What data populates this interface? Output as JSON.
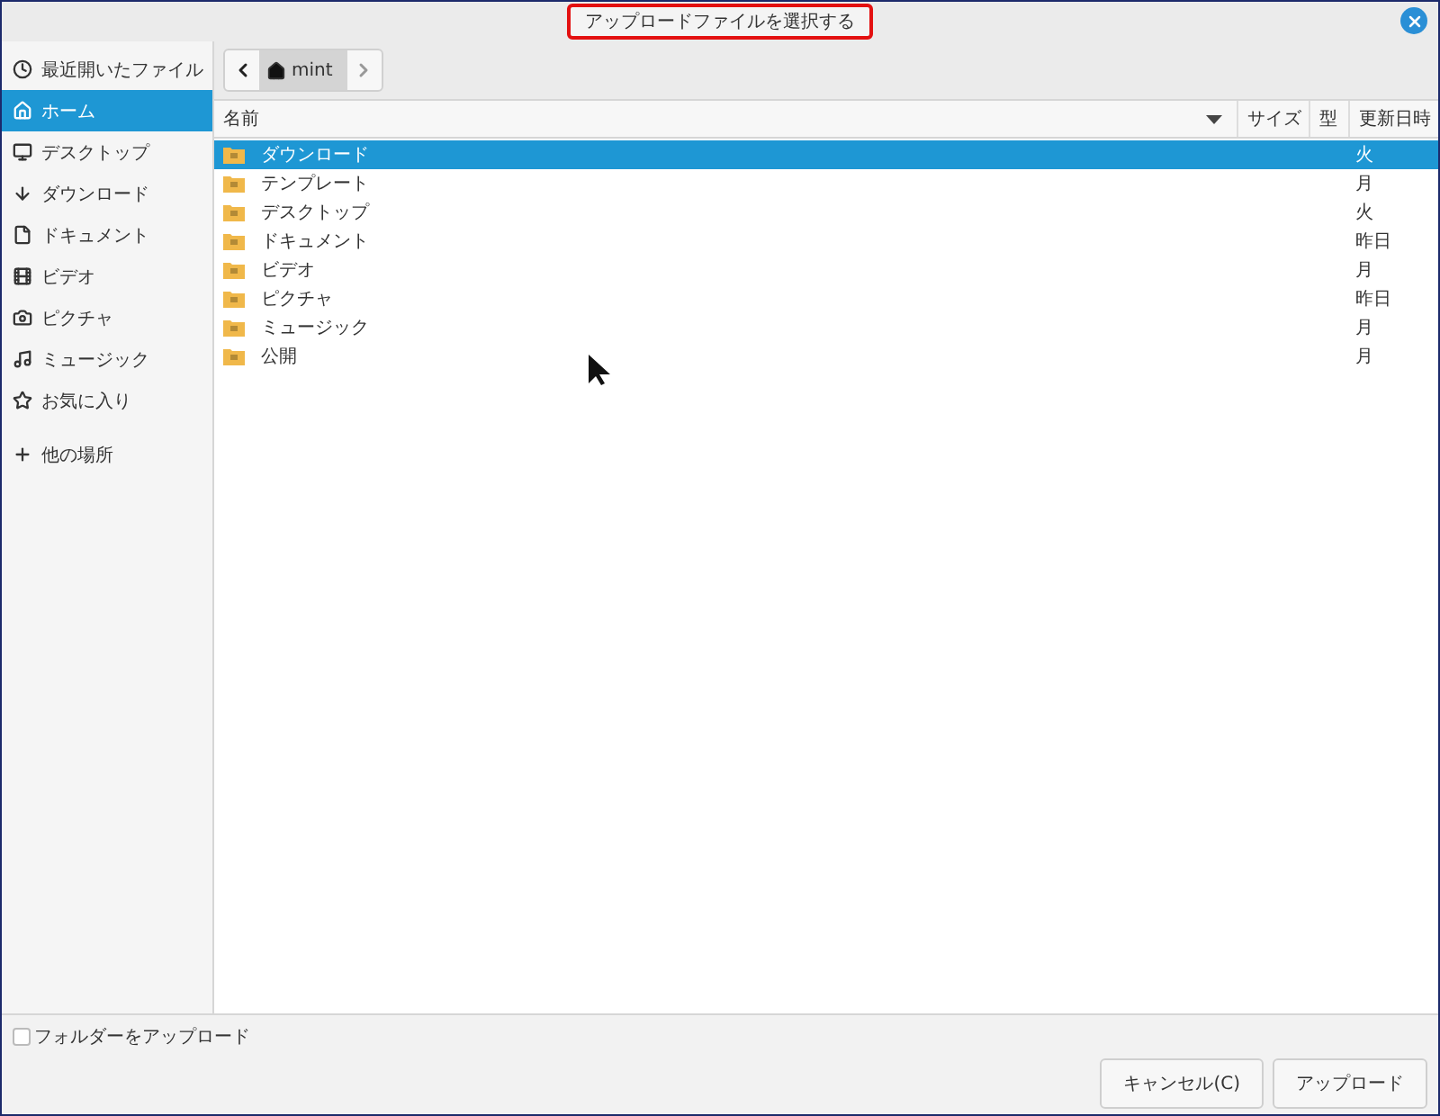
{
  "window": {
    "title": "アップロードファイルを選択する"
  },
  "sidebar": {
    "items": [
      {
        "label": "最近開いたファイル",
        "selected": false
      },
      {
        "label": "ホーム",
        "selected": true
      },
      {
        "label": "デスクトップ",
        "selected": false
      },
      {
        "label": "ダウンロード",
        "selected": false
      },
      {
        "label": "ドキュメント",
        "selected": false
      },
      {
        "label": "ビデオ",
        "selected": false
      },
      {
        "label": "ピクチャ",
        "selected": false
      },
      {
        "label": "ミュージック",
        "selected": false
      },
      {
        "label": "お気に入り",
        "selected": false
      },
      {
        "label": "他の場所",
        "selected": false
      }
    ]
  },
  "path_bar": {
    "segments": [
      {
        "label": "mint",
        "selected": true
      }
    ]
  },
  "table": {
    "columns": [
      "名前",
      "サイズ",
      "型",
      "更新日時"
    ],
    "rows": [
      {
        "name": "ダウンロード",
        "modified": "火",
        "selected": true
      },
      {
        "name": "テンプレート",
        "modified": "月",
        "selected": false
      },
      {
        "name": "デスクトップ",
        "modified": "火",
        "selected": false
      },
      {
        "name": "ドキュメント",
        "modified": "昨日",
        "selected": false
      },
      {
        "name": "ビデオ",
        "modified": "月",
        "selected": false
      },
      {
        "name": "ピクチャ",
        "modified": "昨日",
        "selected": false
      },
      {
        "name": "ミュージック",
        "modified": "月",
        "selected": false
      },
      {
        "name": "公開",
        "modified": "月",
        "selected": false
      }
    ]
  },
  "upload_folder": {
    "label": "フォルダーをアップロード",
    "checked": false
  },
  "buttons": [
    "キャンセル(C)",
    "アップロード"
  ]
}
